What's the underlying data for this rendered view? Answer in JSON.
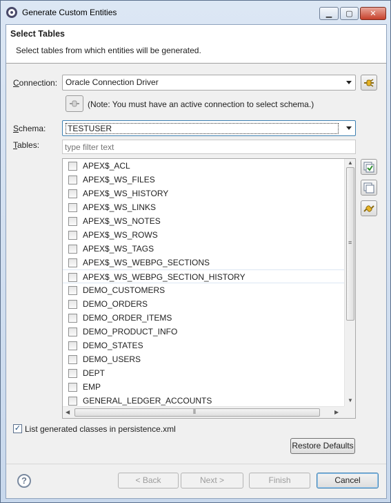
{
  "window": {
    "title": "Generate Custom Entities",
    "minimize": "▁",
    "maximize": "▢",
    "close": "✕"
  },
  "header": {
    "title": "Select Tables",
    "description": "Select tables from which entities will be generated."
  },
  "connection": {
    "label_accel": "C",
    "label_rest": "onnection:",
    "value": "Oracle Connection Driver",
    "note": "(Note: You must have an active connection to select schema.)"
  },
  "schema": {
    "label_accel": "S",
    "label_rest": "chema:",
    "value": "TESTUSER"
  },
  "tables": {
    "label_accel": "T",
    "label_rest": "ables:",
    "filter_placeholder": "type filter text",
    "items": [
      {
        "label": "APEX$_ACL",
        "checked": false
      },
      {
        "label": "APEX$_WS_FILES",
        "checked": false
      },
      {
        "label": "APEX$_WS_HISTORY",
        "checked": false
      },
      {
        "label": "APEX$_WS_LINKS",
        "checked": false
      },
      {
        "label": "APEX$_WS_NOTES",
        "checked": false
      },
      {
        "label": "APEX$_WS_ROWS",
        "checked": false
      },
      {
        "label": "APEX$_WS_TAGS",
        "checked": false
      },
      {
        "label": "APEX$_WS_WEBPG_SECTIONS",
        "checked": false
      },
      {
        "label": "APEX$_WS_WEBPG_SECTION_HISTORY",
        "checked": false
      },
      {
        "label": "DEMO_CUSTOMERS",
        "checked": false
      },
      {
        "label": "DEMO_ORDERS",
        "checked": false
      },
      {
        "label": "DEMO_ORDER_ITEMS",
        "checked": false
      },
      {
        "label": "DEMO_PRODUCT_INFO",
        "checked": false
      },
      {
        "label": "DEMO_STATES",
        "checked": false
      },
      {
        "label": "DEMO_USERS",
        "checked": false
      },
      {
        "label": "DEPT",
        "checked": false
      },
      {
        "label": "EMP",
        "checked": false
      },
      {
        "label": "GENERAL_LEDGER_ACCOUNTS",
        "checked": false
      }
    ],
    "selected_index": 8
  },
  "persistence": {
    "label": "List generated classes in persistence.xml",
    "checked": true
  },
  "buttons": {
    "restore_defaults": "Restore Defaults",
    "back": "< Back",
    "next": "Next >",
    "finish": "Finish",
    "cancel": "Cancel"
  },
  "colors": {
    "title_gradient_top": "#dce7f4",
    "client_bg": "#f0f0f0",
    "accent_border": "#3c7fb1",
    "icon_gold": "#d9a21b"
  },
  "icons": {
    "app": "eclipse-icon",
    "connect": "connect-plug-icon",
    "reconnect": "plug-icon",
    "select_all": "select-all-icon",
    "deselect_all": "deselect-all-icon",
    "refresh": "refresh-icon",
    "help": "help-icon"
  }
}
